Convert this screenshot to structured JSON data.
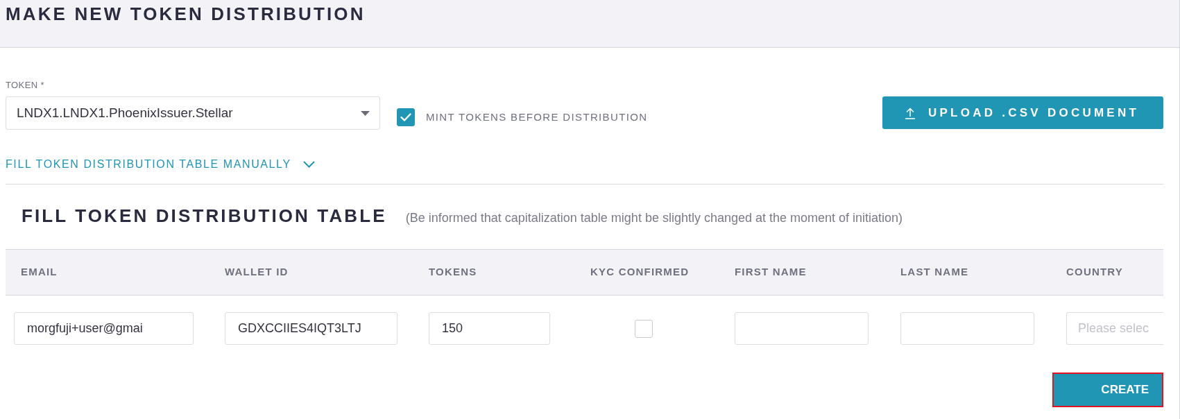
{
  "header": {
    "title": "MAKE NEW TOKEN DISTRIBUTION"
  },
  "token_field": {
    "label": "TOKEN *",
    "value": "LNDX1.LNDX1.PhoenixIssuer.Stellar"
  },
  "mint_option": {
    "label": "MINT TOKENS BEFORE DISTRIBUTION",
    "checked": true
  },
  "upload_button": {
    "label": "UPLOAD .CSV DOCUMENT"
  },
  "manual_fill_link": {
    "label": "FILL TOKEN DISTRIBUTION TABLE MANUALLY"
  },
  "table_section": {
    "title": "FILL TOKEN DISTRIBUTION TABLE",
    "note": "(Be informed that capitalization table might be slightly changed at the moment of initiation)"
  },
  "table": {
    "columns": [
      "EMAIL",
      "WALLET ID",
      "TOKENS",
      "KYC CONFIRMED",
      "FIRST NAME",
      "LAST NAME",
      "COUNTRY"
    ],
    "rows": [
      {
        "cells": [
          {
            "kind": "input",
            "value": "morgfuji+user@gmai"
          },
          {
            "kind": "input",
            "value": "GDXCCIIES4IQT3LTJ"
          },
          {
            "kind": "input",
            "value": "150"
          },
          {
            "kind": "checkbox",
            "checked": false
          },
          {
            "kind": "input"
          },
          {
            "kind": "input"
          },
          {
            "kind": "select",
            "placeholder": "Please selec"
          }
        ]
      }
    ]
  },
  "create_button": {
    "label": "CREATE",
    "focused": true
  }
}
